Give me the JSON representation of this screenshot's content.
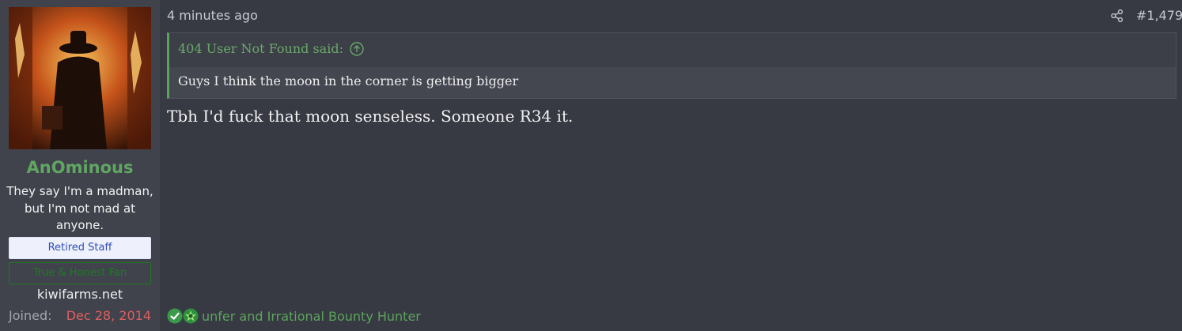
{
  "user": {
    "name": "AnOminous",
    "title": "They say I'm a madman, but I'm not mad at anyone.",
    "banners": [
      "Retired Staff",
      "True & Honest Fan"
    ],
    "site": "kiwifarms.net",
    "joined_label": "Joined:",
    "joined_date": "Dec 28, 2014"
  },
  "post": {
    "timestamp": "4 minutes ago",
    "number": "#1,479",
    "quote": {
      "author_line": "404 User Not Found said:",
      "text": "Guys I think the moon in the corner is getting bigger"
    },
    "body": "Tbh I'd fuck that moon senseless. Someone R34 it.",
    "reactions_text": "unfer and Irrational Bounty Hunter"
  },
  "icons": [
    "share-icon",
    "arrow-up-circle-icon",
    "checkmark-reaction-icon",
    "winner-reaction-icon"
  ],
  "colors": {
    "accent_green": "#61a563",
    "joined_date": "#df5f5f",
    "staff_banner_text": "#3050b8"
  }
}
